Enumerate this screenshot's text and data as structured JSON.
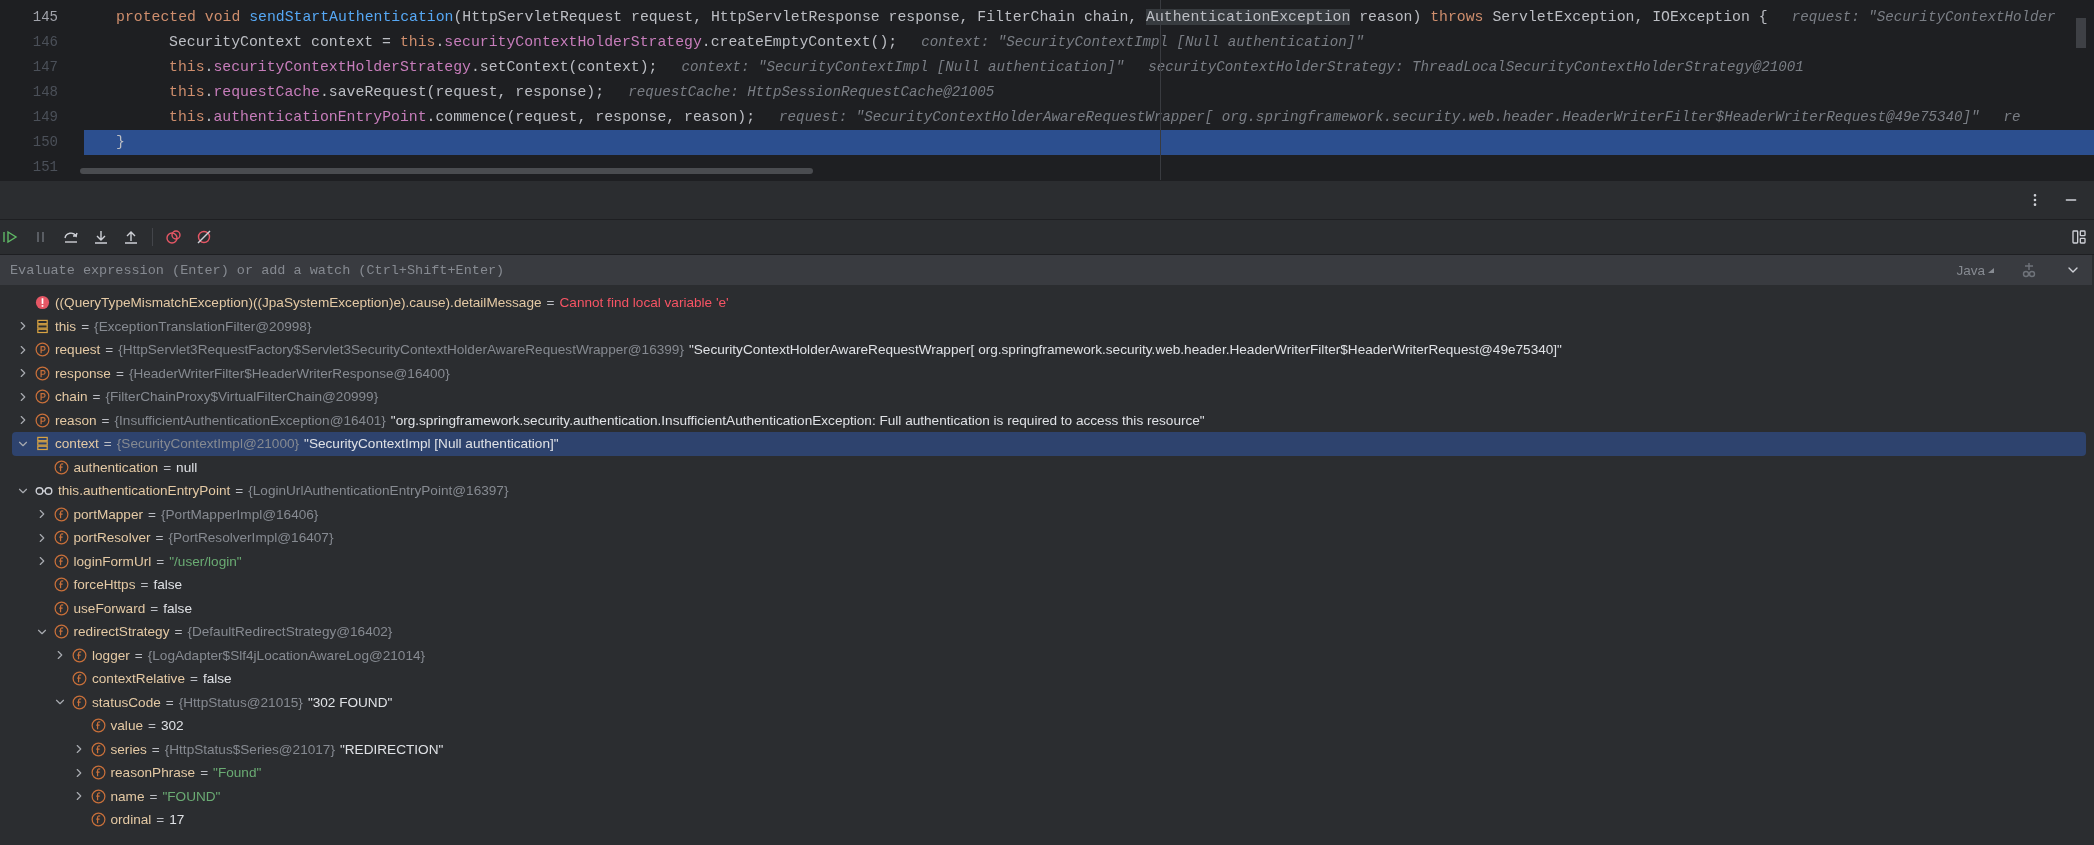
{
  "editor": {
    "lines": [
      {
        "number": "145",
        "selected": false,
        "indented": false,
        "tokens": [
          {
            "kind": "keyword",
            "text": "protected void "
          },
          {
            "kind": "method",
            "text": "sendStartAuthentication"
          },
          {
            "kind": "plain",
            "text": "(HttpServletRequest request, HttpServletResponse response, FilterChain chain, "
          },
          {
            "kind": "highlight",
            "text": "AuthenticationException"
          },
          {
            "kind": "plain",
            "text": " reason) "
          },
          {
            "kind": "keyword",
            "text": "throws "
          },
          {
            "kind": "plain",
            "text": "ServletException, IOException {"
          }
        ],
        "hints": [
          "request: \"SecurityContextHolder"
        ]
      },
      {
        "number": "146",
        "selected": false,
        "indented": true,
        "tokens": [
          {
            "kind": "plain",
            "text": "SecurityContext context = "
          },
          {
            "kind": "keyword",
            "text": "this"
          },
          {
            "kind": "plain",
            "text": "."
          },
          {
            "kind": "field",
            "text": "securityContextHolderStrategy"
          },
          {
            "kind": "plain",
            "text": ".createEmptyContext();"
          }
        ],
        "hints": [
          "context: \"SecurityContextImpl [Null authentication]\""
        ]
      },
      {
        "number": "147",
        "selected": false,
        "indented": true,
        "tokens": [
          {
            "kind": "keyword",
            "text": "this"
          },
          {
            "kind": "plain",
            "text": "."
          },
          {
            "kind": "field",
            "text": "securityContextHolderStrategy"
          },
          {
            "kind": "plain",
            "text": ".setContext(context);"
          }
        ],
        "hints": [
          "context: \"SecurityContextImpl [Null authentication]\"",
          "securityContextHolderStrategy: ThreadLocalSecurityContextHolderStrategy@21001"
        ]
      },
      {
        "number": "148",
        "selected": false,
        "indented": true,
        "tokens": [
          {
            "kind": "keyword",
            "text": "this"
          },
          {
            "kind": "plain",
            "text": "."
          },
          {
            "kind": "field",
            "text": "requestCache"
          },
          {
            "kind": "plain",
            "text": ".saveRequest(request, response);"
          }
        ],
        "hints": [
          "requestCache: HttpSessionRequestCache@21005"
        ]
      },
      {
        "number": "149",
        "selected": false,
        "indented": true,
        "tokens": [
          {
            "kind": "keyword",
            "text": "this"
          },
          {
            "kind": "plain",
            "text": "."
          },
          {
            "kind": "field",
            "text": "authenticationEntryPoint"
          },
          {
            "kind": "plain",
            "text": ".commence(request, response, reason);"
          }
        ],
        "hints": [
          "request: \"SecurityContextHolderAwareRequestWrapper[ org.springframework.security.web.header.HeaderWriterFilter$HeaderWriterRequest@49e75340]\"",
          "re"
        ]
      },
      {
        "number": "150",
        "selected": true,
        "indented": false,
        "tokens": [
          {
            "kind": "plain",
            "text": "}"
          }
        ]
      },
      {
        "number": "151",
        "selected": false
      }
    ]
  },
  "evaluate": {
    "placeholder": "Evaluate expression (Enter) or add a watch (Ctrl+Shift+Enter)",
    "language": "Java"
  },
  "variables": [
    {
      "kind": "error",
      "selected": false,
      "name": "((QueryTypeMismatchException)((JpaSystemException)e).cause).detailMessage",
      "eq": "=",
      "value": "Cannot find local variable 'e'"
    },
    {
      "kind": "object",
      "expanded": false,
      "selected": false,
      "name": "this",
      "eq": "=",
      "ref": "{ExceptionTranslationFilter@20998}"
    },
    {
      "kind": "param",
      "expanded": false,
      "selected": false,
      "name": "request",
      "eq": "=",
      "ref": "{HttpServlet3RequestFactory$Servlet3SecurityContextHolderAwareRequestWrapper@16399}",
      "value": "\"SecurityContextHolderAwareRequestWrapper[ org.springframework.security.web.header.HeaderWriterFilter$HeaderWriterRequest@49e75340]\"",
      "literal": false
    },
    {
      "kind": "param",
      "expanded": false,
      "selected": false,
      "name": "response",
      "eq": "=",
      "ref": "{HeaderWriterFilter$HeaderWriterResponse@16400}"
    },
    {
      "kind": "param",
      "expanded": false,
      "selected": false,
      "name": "chain",
      "eq": "=",
      "ref": "{FilterChainProxy$VirtualFilterChain@20999}"
    },
    {
      "kind": "param",
      "expanded": false,
      "selected": false,
      "name": "reason",
      "eq": "=",
      "ref": "{InsufficientAuthenticationException@16401}",
      "value": "\"org.springframework.security.authentication.InsufficientAuthenticationException: Full authentication is required to access this resource\"",
      "literal": false
    },
    {
      "kind": "object",
      "expanded": true,
      "selected": true,
      "name": "context",
      "eq": "=",
      "ref": "{SecurityContextImpl@21000}",
      "value": "\"SecurityContextImpl [Null authentication]\"",
      "literal": false,
      "children": [
        {
          "kind": "field",
          "selected": false,
          "name": "authentication",
          "eq": "=",
          "value": "null",
          "literal": false
        }
      ]
    },
    {
      "kind": "watch",
      "expanded": true,
      "selected": false,
      "name": "this.authenticationEntryPoint",
      "eq": "=",
      "ref": "{LoginUrlAuthenticationEntryPoint@16397}",
      "children": [
        {
          "kind": "field",
          "expanded": false,
          "selected": false,
          "name": "portMapper",
          "eq": "=",
          "ref": "{PortMapperImpl@16406}"
        },
        {
          "kind": "field",
          "expanded": false,
          "selected": false,
          "name": "portResolver",
          "eq": "=",
          "ref": "{PortResolverImpl@16407}"
        },
        {
          "kind": "field",
          "expanded": false,
          "selected": false,
          "name": "loginFormUrl",
          "eq": "=",
          "value": "\"/user/login\"",
          "literal": true
        },
        {
          "kind": "field",
          "selected": false,
          "name": "forceHttps",
          "eq": "=",
          "value": "false",
          "literal": false
        },
        {
          "kind": "field",
          "selected": false,
          "name": "useForward",
          "eq": "=",
          "value": "false",
          "literal": false
        },
        {
          "kind": "field",
          "expanded": true,
          "selected": false,
          "name": "redirectStrategy",
          "eq": "=",
          "ref": "{DefaultRedirectStrategy@16402}",
          "children": [
            {
              "kind": "field",
              "expanded": false,
              "selected": false,
              "name": "logger",
              "eq": "=",
              "ref": "{LogAdapter$Slf4jLocationAwareLog@21014}"
            },
            {
              "kind": "field",
              "selected": false,
              "name": "contextRelative",
              "eq": "=",
              "value": "false",
              "literal": false
            },
            {
              "kind": "field",
              "expanded": true,
              "selected": false,
              "name": "statusCode",
              "eq": "=",
              "ref": "{HttpStatus@21015}",
              "value": "\"302 FOUND\"",
              "literal": false,
              "children": [
                {
                  "kind": "field",
                  "selected": false,
                  "name": "value",
                  "eq": "=",
                  "value": "302",
                  "literal": false
                },
                {
                  "kind": "field",
                  "expanded": false,
                  "selected": false,
                  "name": "series",
                  "eq": "=",
                  "ref": "{HttpStatus$Series@21017}",
                  "value": "\"REDIRECTION\"",
                  "literal": false
                },
                {
                  "kind": "field",
                  "expanded": false,
                  "selected": false,
                  "name": "reasonPhrase",
                  "eq": "=",
                  "value": "\"Found\"",
                  "literal": true
                },
                {
                  "kind": "field",
                  "expanded": false,
                  "selected": false,
                  "name": "name",
                  "eq": "=",
                  "value": "\"FOUND\"",
                  "literal": true
                },
                {
                  "kind": "field",
                  "selected": false,
                  "name": "ordinal",
                  "eq": "=",
                  "value": "17",
                  "literal": false
                }
              ]
            }
          ]
        }
      ]
    }
  ]
}
